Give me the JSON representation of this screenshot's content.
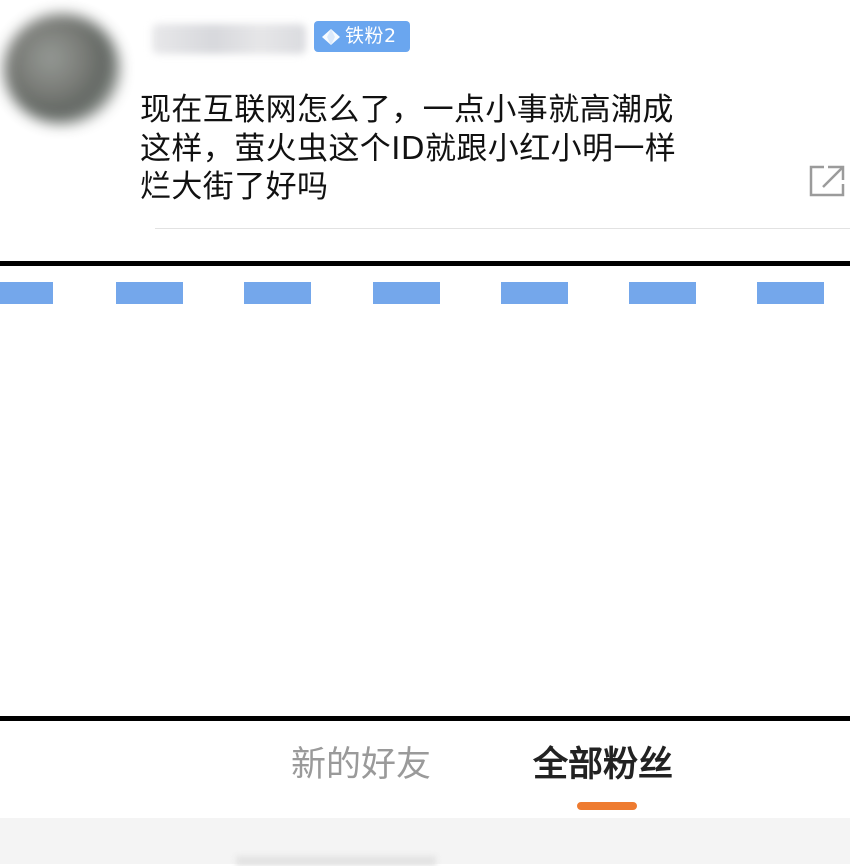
{
  "comment": {
    "fan_badge": "铁粉2",
    "lines": [
      "现在互联网怎么了，一点小事就高潮成",
      "这样，萤火虫这个ID就跟小红小明一样",
      "烂大街了好吗"
    ]
  },
  "tabs": {
    "new_friends": "新的好友",
    "all_fans": "全部粉丝",
    "active_tab": "全部粉丝"
  },
  "colors": {
    "badge": "#6aa6ef",
    "dash": "#74a7eb",
    "tab_indicator": "#ee7b30",
    "tab_active": "#222222",
    "tab_inactive": "#9a9a9a"
  },
  "icons": {
    "badge": "diamond-icon",
    "share": "share-external-icon"
  }
}
